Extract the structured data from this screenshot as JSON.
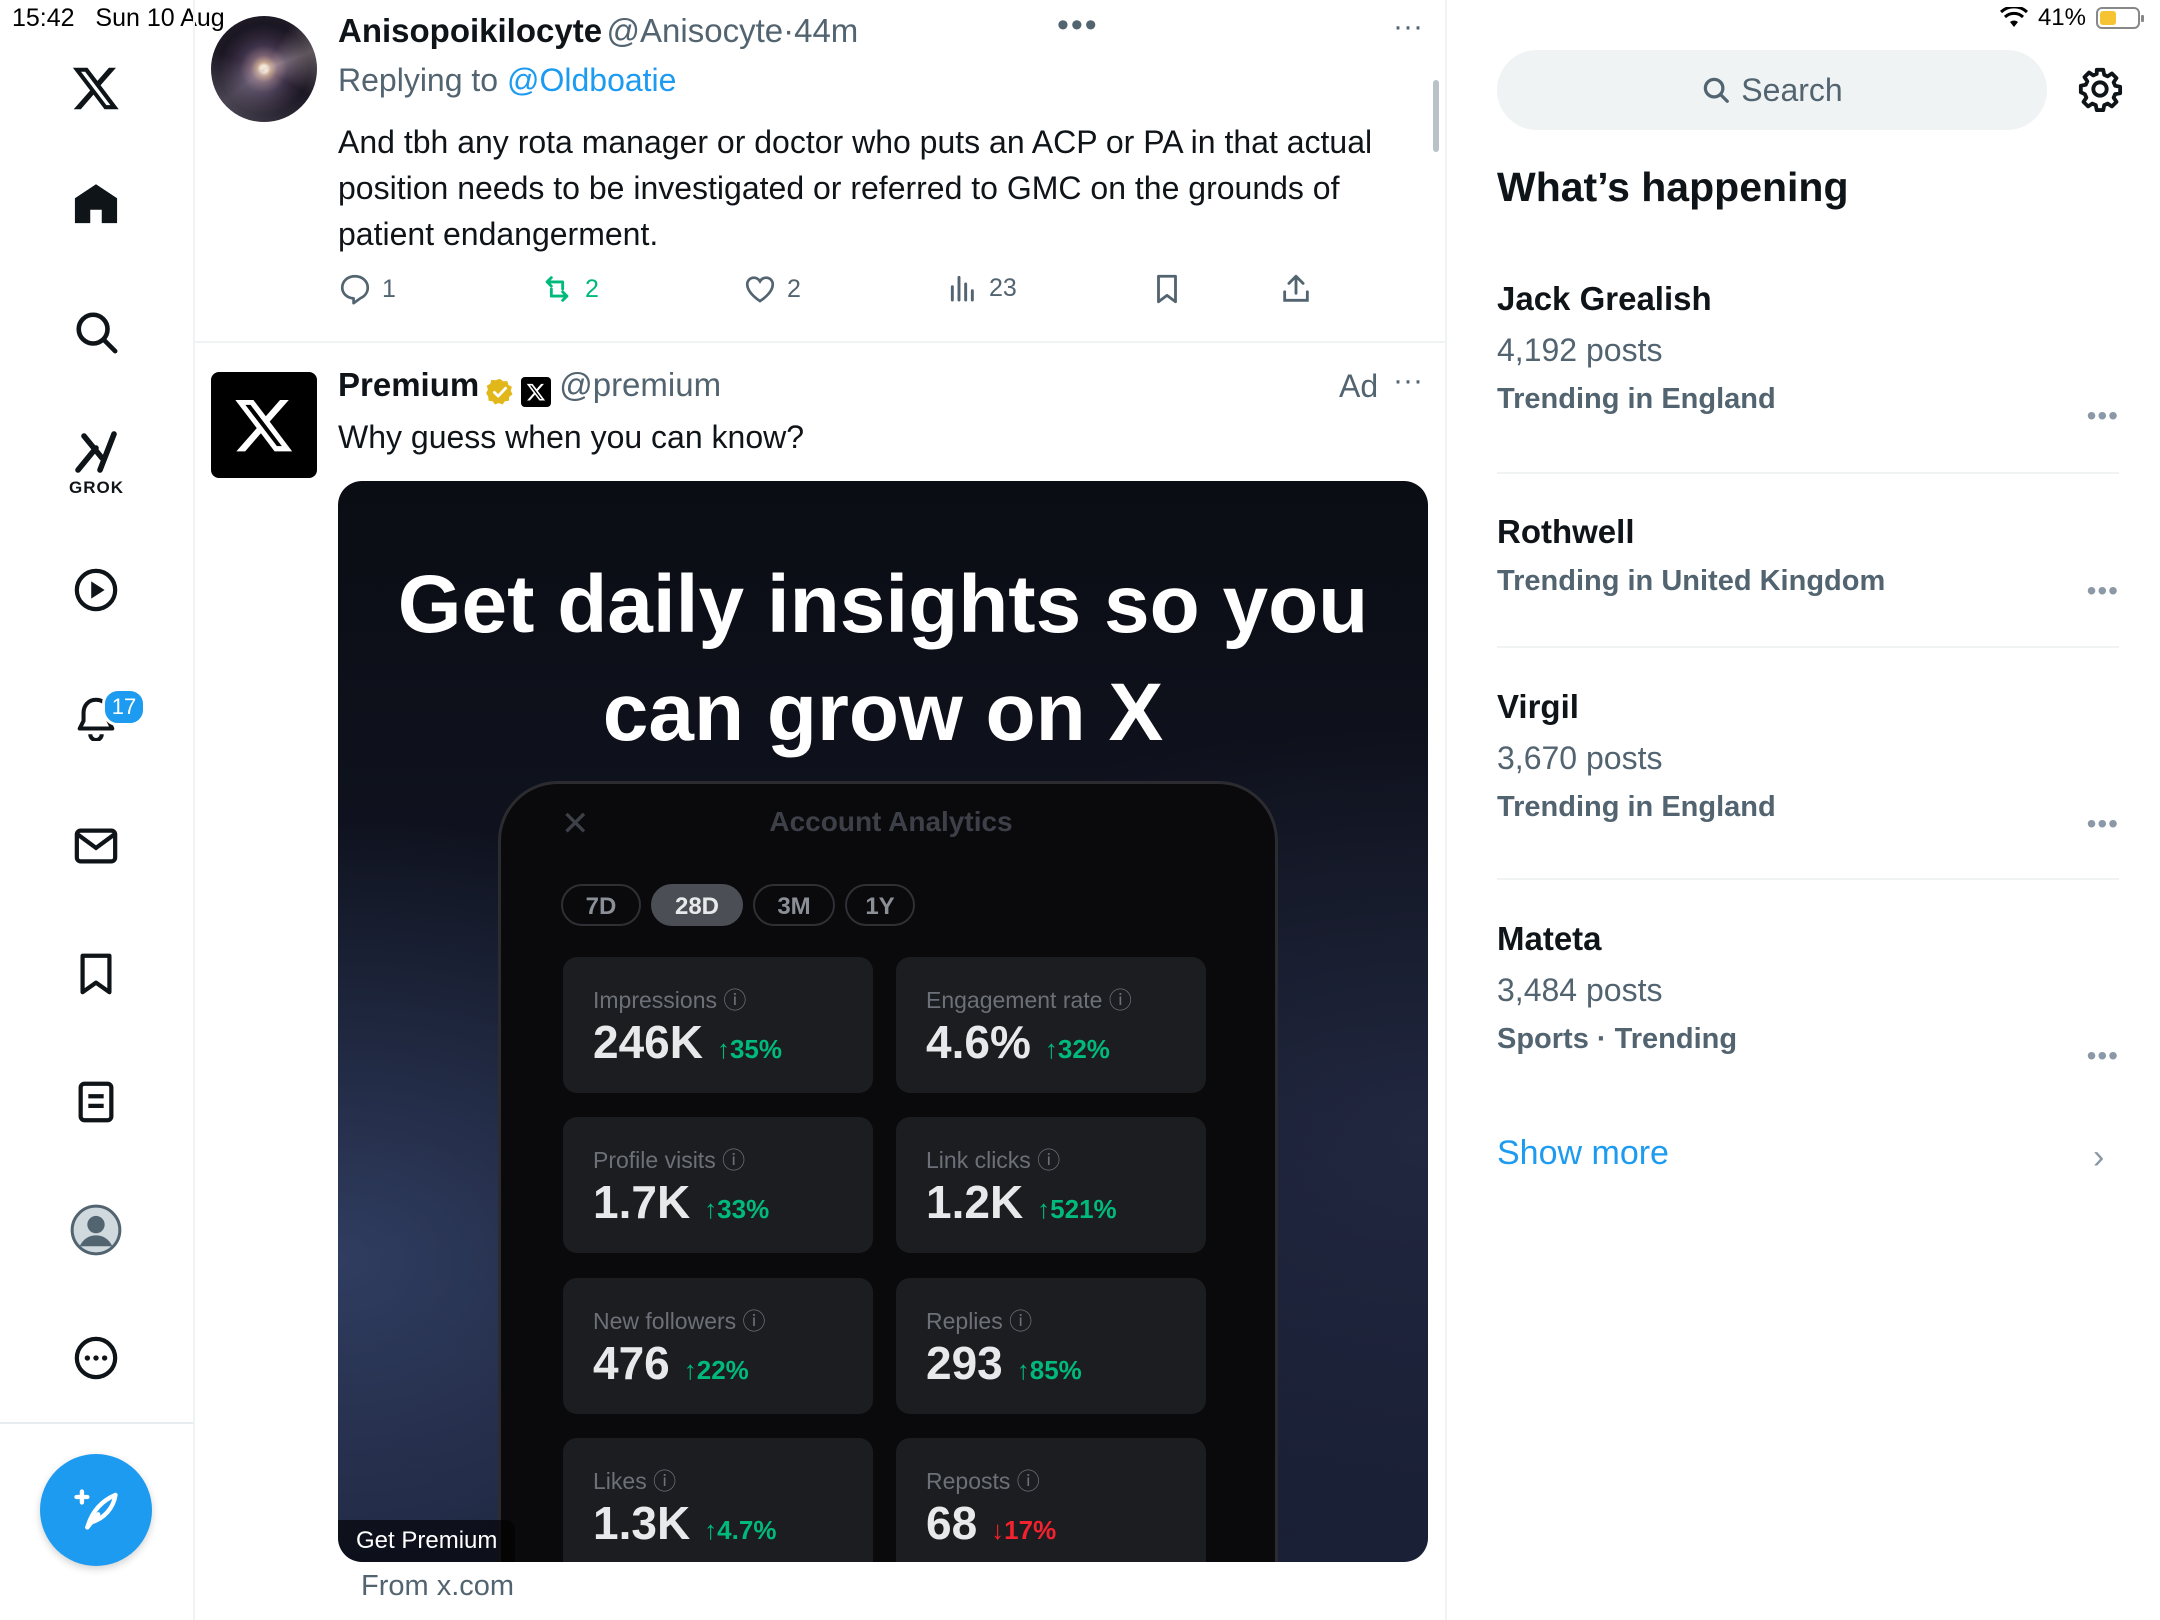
{
  "status_bar": {
    "time": "15:42",
    "date": "Sun 10 Aug",
    "battery": "41%"
  },
  "nav": {
    "grok_label": "GROK",
    "notifications_badge": "17"
  },
  "tweet": {
    "display_name": "Anisopoikilocyte",
    "handle": "@Anisocyte",
    "dot": "·",
    "time": "44m",
    "replying_prefix": "Replying to",
    "replying_handle": "@Oldboatie",
    "text": "And tbh any rota manager or doctor who puts an ACP or PA in that actual position needs to be investigated or referred to GMC on the grounds of patient endangerment.",
    "replies": "1",
    "reposts": "2",
    "likes": "2",
    "views": "23"
  },
  "ad": {
    "display_name": "Premium",
    "handle": "@premium",
    "ad_label": "Ad",
    "text": "Why guess when you can know?",
    "headline": "Get daily insights so you can grow on X",
    "panel_title": "Account Analytics",
    "ranges": [
      "7D",
      "28D",
      "3M",
      "1Y"
    ],
    "stats": [
      {
        "label": "Impressions",
        "value": "246K",
        "delta": "↑35%",
        "dir": "up"
      },
      {
        "label": "Engagement rate",
        "value": "4.6%",
        "delta": "↑32%",
        "dir": "up"
      },
      {
        "label": "Profile visits",
        "value": "1.7K",
        "delta": "↑33%",
        "dir": "up"
      },
      {
        "label": "Link clicks",
        "value": "1.2K",
        "delta": "↑521%",
        "dir": "up"
      },
      {
        "label": "New followers",
        "value": "476",
        "delta": "↑22%",
        "dir": "up"
      },
      {
        "label": "Replies",
        "value": "293",
        "delta": "↑85%",
        "dir": "up"
      },
      {
        "label": "Likes",
        "value": "1.3K",
        "delta": "↑4.7%",
        "dir": "up"
      },
      {
        "label": "Reposts",
        "value": "68",
        "delta": "↓17%",
        "dir": "down"
      }
    ],
    "cta": "Get Premium",
    "source": "From x.com"
  },
  "right": {
    "search_placeholder": "Search",
    "heading": "What’s happening",
    "trends": [
      {
        "title": "Jack Grealish",
        "posts": "4,192 posts",
        "context": "Trending in England"
      },
      {
        "title": "Rothwell",
        "posts": "",
        "context": "Trending in United Kingdom"
      },
      {
        "title": "Virgil",
        "posts": "3,670 posts",
        "context": "Trending in England"
      },
      {
        "title": "Mateta",
        "posts": "3,484 posts",
        "context": "Sports · Trending"
      }
    ],
    "show_more": "Show more"
  },
  "colors": {
    "accent": "#1d9bf0",
    "up": "#00ba7c",
    "down": "#f4212e",
    "verified": "#e2b719"
  }
}
